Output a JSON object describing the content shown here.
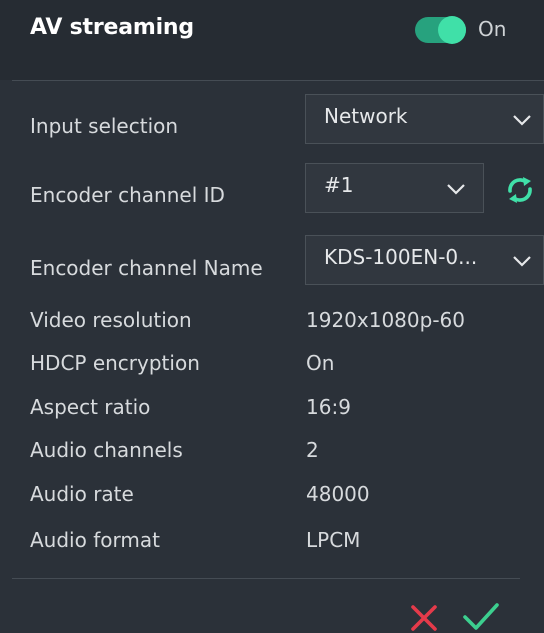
{
  "header": {
    "title": "AV streaming",
    "toggle_label": "On",
    "toggle_state": "on"
  },
  "fields": {
    "input_selection": {
      "label": "Input selection",
      "value": "Network"
    },
    "encoder_channel_id": {
      "label": "Encoder channel ID",
      "value": "#1"
    },
    "encoder_channel_name": {
      "label": "Encoder channel Name",
      "value": "KDS-100EN-0..."
    }
  },
  "info": [
    {
      "label": "Video resolution",
      "value": "1920x1080p-60"
    },
    {
      "label": "HDCP encryption",
      "value": "On"
    },
    {
      "label": "Aspect ratio",
      "value": "16:9"
    },
    {
      "label": "Audio channels",
      "value": "2"
    },
    {
      "label": "Audio rate",
      "value": "48000"
    },
    {
      "label": "Audio format",
      "value": "LPCM"
    }
  ],
  "icons": {
    "refresh": "refresh-icon",
    "cancel": "close-icon",
    "confirm": "check-icon"
  },
  "colors": {
    "accent": "#40e0a8",
    "toggle_track": "#27a27e",
    "cancel": "#e53a4a",
    "confirm": "#3ccf8f",
    "background": "#2b3139"
  }
}
